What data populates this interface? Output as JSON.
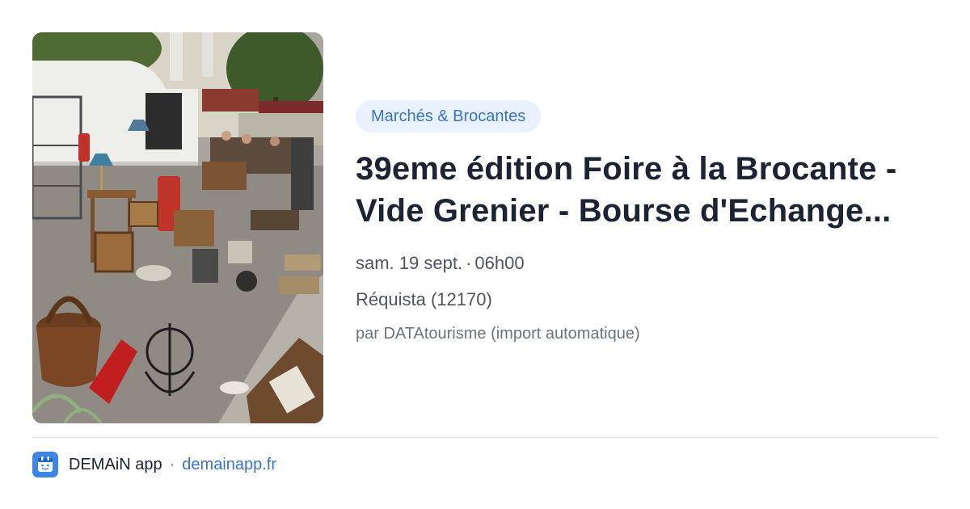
{
  "event": {
    "category": "Marchés & Brocantes",
    "title": "39eme édition Foire à la Brocante - Vide Grenier - Bourse d'Echange...",
    "date": "sam. 19 sept.",
    "separator": "·",
    "time": "06h00",
    "location": "Réquista (12170)",
    "source": "par DATAtourisme (import automatique)"
  },
  "footer": {
    "app_name": "DEMAiN app",
    "separator": "·",
    "domain": "demainapp.fr",
    "icon": "demain-app-icon"
  },
  "colors": {
    "tag_background": "#e8f1fc",
    "accent": "#3a74c6",
    "app_icon": "#3d86e4"
  }
}
